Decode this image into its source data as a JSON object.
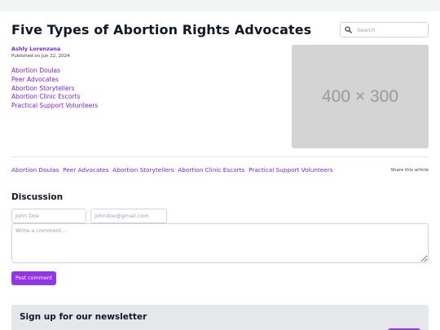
{
  "article": {
    "title": "Five Types of Abortion Rights Advocates",
    "author": "Ashly Lorenzana",
    "published": "Published on Jun 22, 2024",
    "image_label": "400 × 300",
    "toc": [
      "Abortion Doulas",
      "Peer Advocates",
      "Abortion Storytellers",
      "Abortion Clinic Escorts",
      "Practical Support Volunteers"
    ],
    "tags": [
      "Abortion Doulas",
      "Peer Advocates",
      "Abortion Storytellers",
      "Abortion Clinic Escorts",
      "Practical Support Volunteers"
    ],
    "share_label": "Share this article"
  },
  "search": {
    "placeholder": "Search",
    "icon": "search-icon"
  },
  "discussion": {
    "heading": "Discussion",
    "name_placeholder": "John Doe",
    "email_placeholder": "johndoe@gmail.com",
    "comment_placeholder": "Write a comment...",
    "submit_label": "Post comment"
  },
  "newsletter": {
    "title": "Sign up for our newsletter"
  },
  "colors": {
    "accent": "#9333ea",
    "link": "#7e22ce",
    "placeholder_bg": "#d4d4d4"
  }
}
